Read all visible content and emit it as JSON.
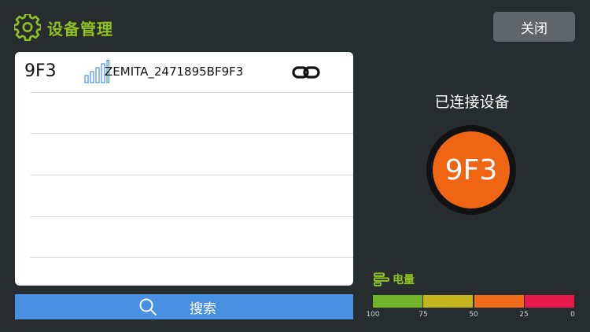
{
  "header": {
    "title": "设备管理",
    "icon": "gear-icon",
    "accent_color": "#8dc21f"
  },
  "close_button": {
    "label": "关闭"
  },
  "device_list": {
    "rows": [
      {
        "short_id": "9F3",
        "name": "ZEMITA_2471895BF9F3",
        "signal_icon": "signal-strength-icon",
        "link_icon": "link-icon"
      }
    ]
  },
  "search": {
    "label": "搜索",
    "icon": "search-icon",
    "color": "#4a90e2"
  },
  "connected": {
    "label": "已连接设备",
    "device_short": "9F3",
    "color": "#f06514"
  },
  "battery": {
    "label": "电量",
    "segment_colors": [
      "#6fb527",
      "#c6b51f",
      "#ef6a1a",
      "#e8184a"
    ],
    "ticks": [
      "100",
      "75",
      "50",
      "25",
      "0"
    ]
  }
}
